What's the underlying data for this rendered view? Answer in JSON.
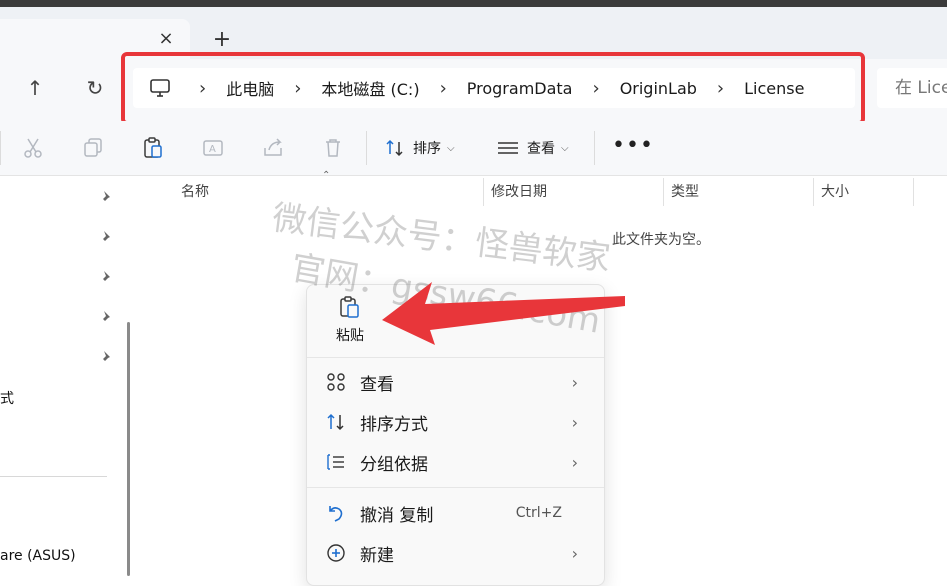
{
  "tab": {
    "close_glyph": "×",
    "new_glyph": "+"
  },
  "nav": {
    "up_glyph": "↑",
    "refresh_glyph": "↻"
  },
  "breadcrumb": {
    "separator": "›",
    "items": [
      "此电脑",
      "本地磁盘 (C:)",
      "ProgramData",
      "OriginLab",
      "License"
    ]
  },
  "search": {
    "placeholder": "在 License 中搜索"
  },
  "toolbar": {
    "sort_label": "排序",
    "view_label": "查看",
    "more_glyph": "•••"
  },
  "columns": [
    "名称",
    "修改日期",
    "类型",
    "大小"
  ],
  "empty_message": "此文件夹为空。",
  "sidebar": {
    "partial_item_1": "式",
    "partial_item_2": "are (ASUS)"
  },
  "context_menu": {
    "paste_label": "粘贴",
    "items": [
      {
        "label": "查看",
        "submenu": true
      },
      {
        "label": "排序方式",
        "submenu": true
      },
      {
        "label": "分组依据",
        "submenu": true
      },
      {
        "label": "撤消 复制",
        "shortcut": "Ctrl+Z"
      },
      {
        "label": "新建",
        "submenu": true
      }
    ],
    "submenu_glyph": "›"
  },
  "watermark": {
    "line1": "微信公众号：怪兽软家",
    "line2": "官网：gssw66.com"
  },
  "colors": {
    "highlight_frame": "#e8363a",
    "arrow": "#e8363a",
    "chrome_bg": "#f7f8fa"
  }
}
